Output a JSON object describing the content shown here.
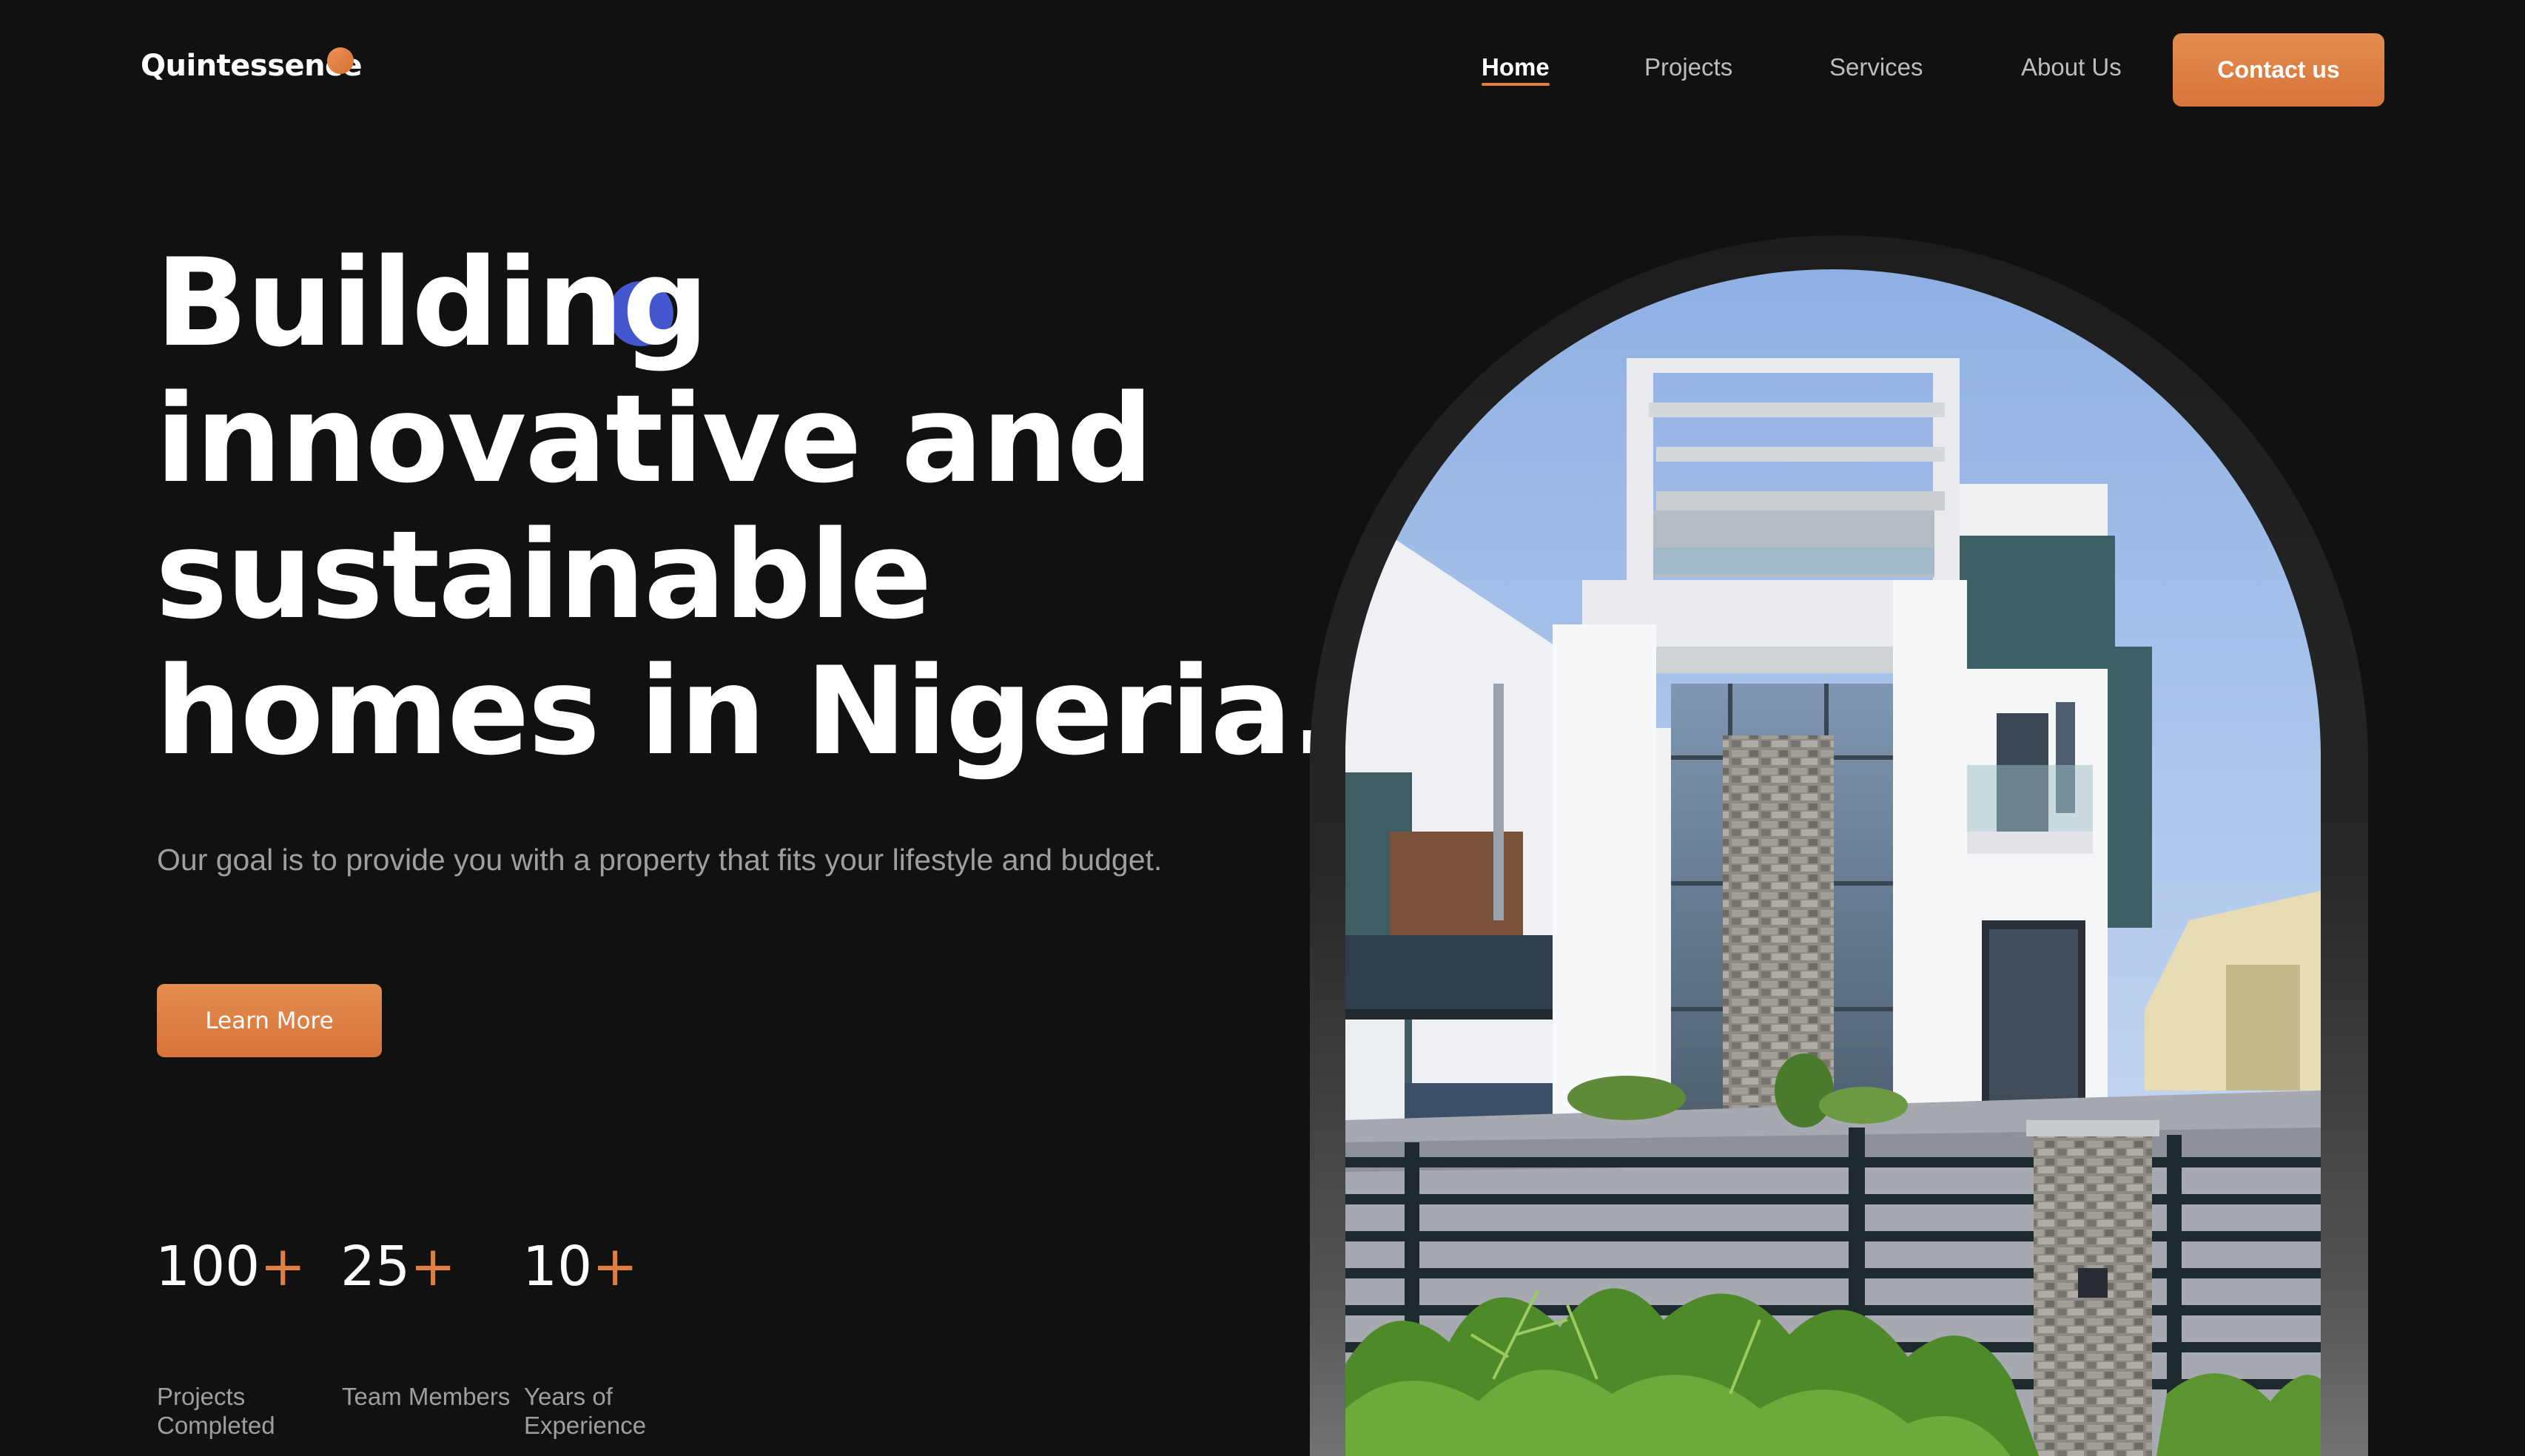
{
  "brand": {
    "name": "Quintessence",
    "accent_color": "#e07f3f",
    "dot_color": "#3a4fd6"
  },
  "nav": {
    "items": [
      {
        "label": "Home",
        "active": true
      },
      {
        "label": "Projects",
        "active": false
      },
      {
        "label": "Services",
        "active": false
      },
      {
        "label": "About Us",
        "active": false
      }
    ],
    "cta_label": "Contact us"
  },
  "hero": {
    "headline_lines": [
      "Building",
      "innovative and",
      "sustainable",
      "homes in Nigeria."
    ],
    "subtext": "Our goal is to provide you with a property that fits your lifestyle and budget.",
    "button_label": "Learn More"
  },
  "stats": [
    {
      "value": "100",
      "suffix": "+",
      "label": "Projects Completed"
    },
    {
      "value": "25",
      "suffix": "+",
      "label": "Team Members"
    },
    {
      "value": "10",
      "suffix": "+",
      "label": "Years of Experience"
    }
  ],
  "image": {
    "subject": "modern-white-house-photo"
  }
}
